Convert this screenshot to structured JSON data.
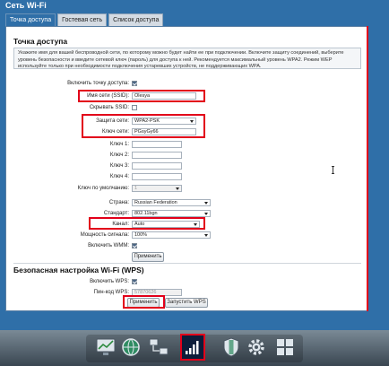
{
  "window": {
    "title": "Сеть Wi-Fi"
  },
  "tabs": [
    {
      "label": "Точка доступа"
    },
    {
      "label": "Гостевая сеть"
    },
    {
      "label": "Список доступа"
    }
  ],
  "access_point": {
    "title": "Точка доступа",
    "info": "Укажите имя для вашей беспроводной сети, по которому можно будет найти ее при подключении. Включите защиту соединений, выберите уровень безопасности и введите сетевой ключ (пароль) для доступа к ней. Рекомендуется максимальный уровень WPA2. Режим WEP используйте только при необходимости подключения устаревших устройств, не поддерживающих WPA.",
    "enable_label": "Включить точку доступа:",
    "ssid_label": "Имя сети (SSID):",
    "ssid_value": "Olesya",
    "hide_ssid_label": "Скрывать SSID:",
    "security_label": "Защита сети:",
    "security_value": "WPA2-PSK",
    "key_label": "Ключ сети:",
    "key_value": "PGsyGy66",
    "key1_label": "Ключ 1:",
    "key2_label": "Ключ 2:",
    "key3_label": "Ключ 3:",
    "key4_label": "Ключ 4:",
    "default_key_label": "Ключ по умолчанию:",
    "default_key_value": "1",
    "country_label": "Страна:",
    "country_value": "Russian Federation",
    "standard_label": "Стандарт:",
    "standard_value": "802.11bgn",
    "channel_label": "Канал:",
    "channel_value": "Auto",
    "power_label": "Мощность сигнала:",
    "power_value": "100%",
    "wmm_label": "Включить WMM:",
    "apply_label": "Применить"
  },
  "wps": {
    "title": "Безопасная настройка Wi-Fi (WPS)",
    "enable_label": "Включить WPS:",
    "pin_label": "Пин-код WPS:",
    "pin_value": "57870626",
    "apply_label": "Применить",
    "run_label": "Запустить WPS"
  },
  "dock": {
    "items": [
      {
        "icon": "monitor-chart-icon"
      },
      {
        "icon": "globe-icon"
      },
      {
        "icon": "network-computers-icon"
      },
      {
        "icon": "wifi-signal-icon"
      },
      {
        "icon": "shield-icon"
      },
      {
        "icon": "gear-icon"
      },
      {
        "icon": "apps-grid-icon"
      }
    ]
  },
  "colors": {
    "accent": "#2f6fa8",
    "highlight": "#e2001a"
  }
}
